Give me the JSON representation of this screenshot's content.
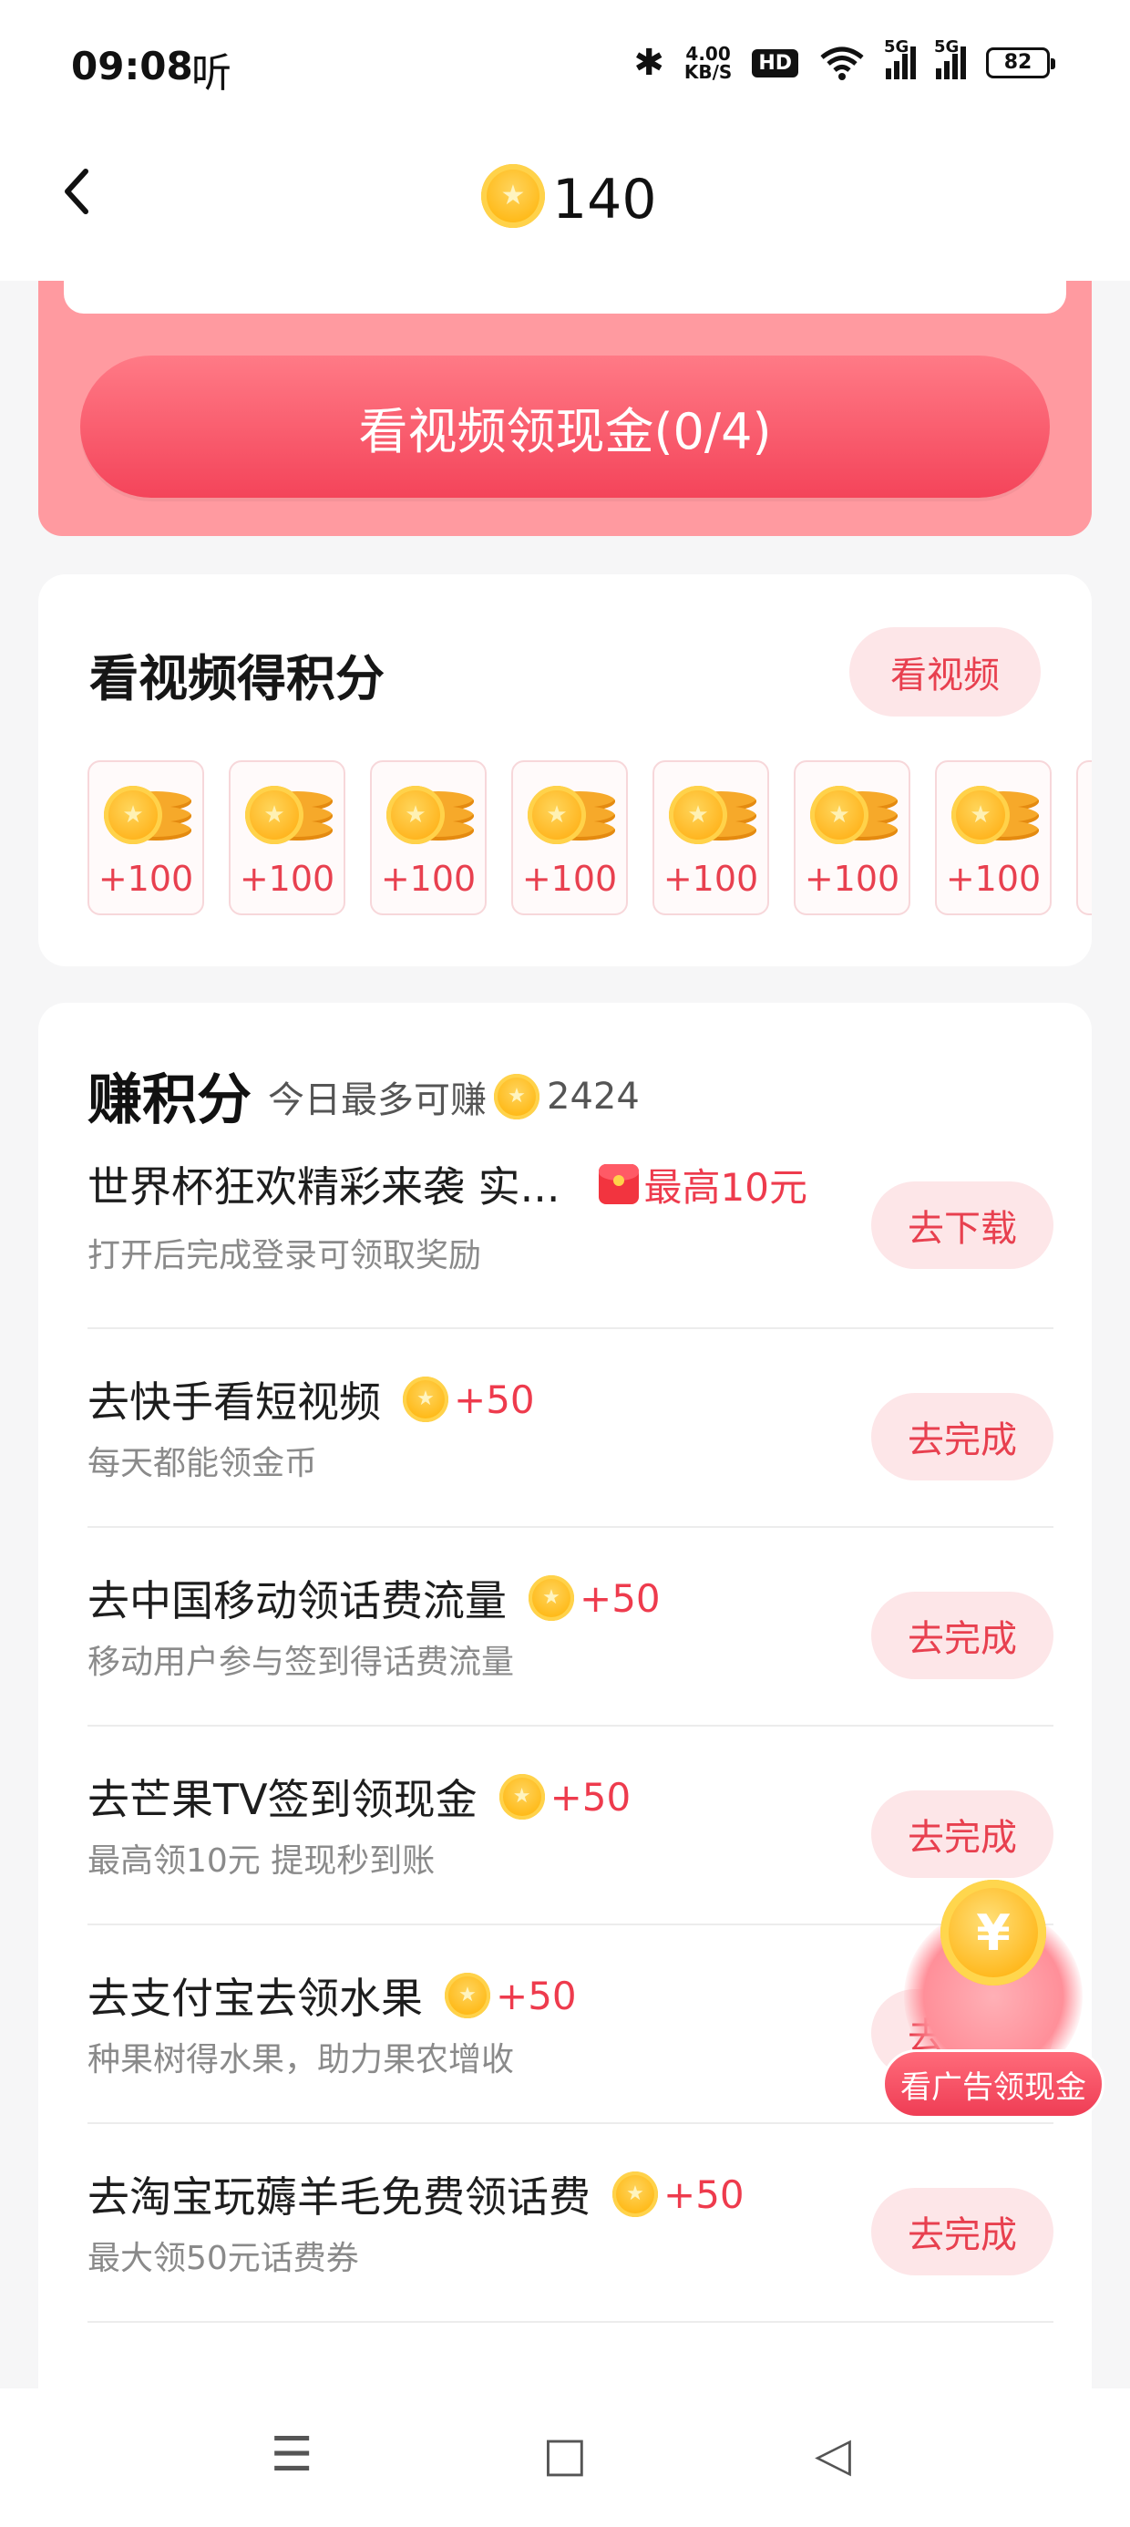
{
  "status_bar": {
    "time": "09:08",
    "ting": "听",
    "net_speed_value": "4.00",
    "net_speed_unit": "KB/S",
    "hd": "HD",
    "sig1": "5G",
    "sig2": "5G",
    "battery": "82"
  },
  "header": {
    "coin_count": "140"
  },
  "banner": {
    "button_label": "看视频领现金(0/4)"
  },
  "video_section": {
    "title": "看视频得积分",
    "button_label": "看视频",
    "rewards": [
      "+100",
      "+100",
      "+100",
      "+100",
      "+100",
      "+100",
      "+100"
    ]
  },
  "earn_section": {
    "title": "赚积分",
    "subtitle_prefix": "今日最多可赚",
    "subtitle_value": "2424",
    "tasks": [
      {
        "title": "世界杯狂欢精彩来袭 实...",
        "reward": "最高10元",
        "desc": "打开后完成登录可领取奖励",
        "button": "去下载"
      },
      {
        "title": "去快手看短视频",
        "reward": "+50",
        "desc": "每天都能领金币",
        "button": "去完成"
      },
      {
        "title": "去中国移动领话费流量",
        "reward": "+50",
        "desc": "移动用户参与签到得话费流量",
        "button": "去完成"
      },
      {
        "title": "去芒果TV签到领现金",
        "reward": "+50",
        "desc": "最高领10元 提现秒到账",
        "button": "去完成"
      },
      {
        "title": "去支付宝去领水果",
        "reward": "+50",
        "desc": "种果树得水果，助力果农增收",
        "button": "去完成"
      },
      {
        "title": "去淘宝玩薅羊毛免费领话费",
        "reward": "+50",
        "desc": "最大领50元话费券",
        "button": "去完成"
      }
    ]
  },
  "float_ad": {
    "label": "看广告领现金",
    "symbol": "¥"
  },
  "nav": {
    "menu": "☰",
    "home": "□",
    "back": "◁"
  },
  "colors": {
    "accent": "#ee3b4d",
    "banner_bg": "#ff9aa0",
    "button_bg": "#fde6e8"
  }
}
